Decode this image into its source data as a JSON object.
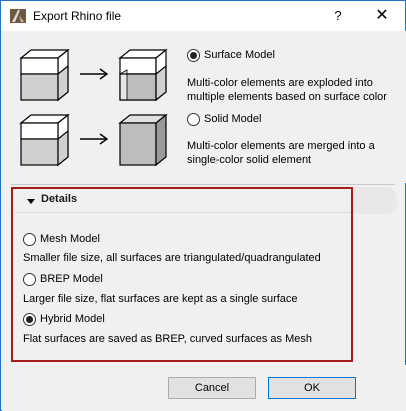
{
  "window": {
    "title": "Export Rhino file",
    "help_label": "?",
    "close_label": "✕"
  },
  "export_type": {
    "surface_model": {
      "label": "Surface Model",
      "selected": true,
      "description_line1": "Multi-color elements are exploded into",
      "description_line2": "multiple elements based on surface color"
    },
    "solid_model": {
      "label": "Solid Model",
      "selected": false,
      "description_line1": "Multi-color elements are merged into a",
      "description_line2": "single-color solid element"
    }
  },
  "details": {
    "header": "Details",
    "mesh_model": {
      "label": "Mesh Model",
      "selected": false,
      "description": "Smaller file size, all surfaces are triangulated/quadrangulated"
    },
    "brep_model": {
      "label": "BREP Model",
      "selected": false,
      "description": "Larger file size, flat surfaces are kept as a single surface"
    },
    "hybrid_model": {
      "label": "Hybrid Model",
      "selected": true,
      "description": "Flat surfaces are saved as BREP, curved surfaces as Mesh"
    }
  },
  "buttons": {
    "cancel": "Cancel",
    "ok": "OK"
  },
  "colors": {
    "highlight_border": "#a61c1c",
    "window_border": "#1f74c9",
    "default_button_border": "#0078d7"
  }
}
